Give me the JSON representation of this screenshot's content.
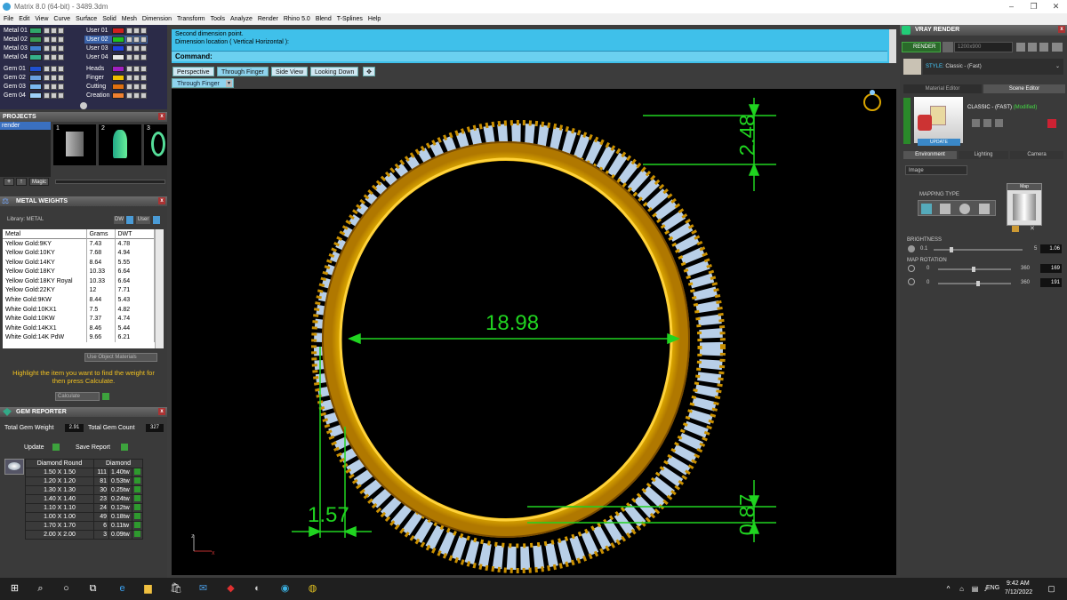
{
  "window": {
    "title": "Matrix 8.0 (64-bit) - 3489.3dm"
  },
  "menu": [
    "File",
    "Edit",
    "View",
    "Curve",
    "Surface",
    "Solid",
    "Mesh",
    "Dimension",
    "Transform",
    "Tools",
    "Analyze",
    "Render",
    "Rhino 5.0",
    "Blend",
    "T-Splines",
    "Help"
  ],
  "layers": {
    "left": [
      {
        "name": "Metal 01",
        "color": "#2fa86a"
      },
      {
        "name": "Metal 02",
        "color": "#3a9a55"
      },
      {
        "name": "Metal 03",
        "color": "#3f7fd0"
      },
      {
        "name": "Metal 04",
        "color": "#35b08a"
      },
      {
        "name": "Gem 01",
        "color": "#2050d0"
      },
      {
        "name": "Gem 02",
        "color": "#6aa0e0"
      },
      {
        "name": "Gem 03",
        "color": "#7ab8f0"
      },
      {
        "name": "Gem 04",
        "color": "#9fd0f8"
      }
    ],
    "right": [
      {
        "name": "User 01",
        "color": "#d02020"
      },
      {
        "name": "User 02",
        "color": "#20c020"
      },
      {
        "name": "User 03",
        "color": "#2040e0"
      },
      {
        "name": "User 04",
        "color": "#e8e8e8"
      },
      {
        "name": "Heads",
        "color": "#a020c0"
      },
      {
        "name": "Finger",
        "color": "#f0c000"
      },
      {
        "name": "Cutting",
        "color": "#e07010"
      },
      {
        "name": "Creation",
        "color": "#f08030"
      }
    ]
  },
  "projects": {
    "title": "PROJECTS",
    "item": "render",
    "thumbs": [
      "1",
      "2",
      "3"
    ],
    "magic_label": "Magic"
  },
  "metal_weights": {
    "title": "METAL WEIGHTS",
    "library_label": "Library: METAL",
    "dw_label": "DW",
    "user_label": "User",
    "columns": [
      "Metal",
      "Grams",
      "DWT"
    ],
    "rows": [
      [
        "Yellow Gold:9KY",
        "7.43",
        "4.78"
      ],
      [
        "Yellow Gold:10KY",
        "7.68",
        "4.94"
      ],
      [
        "Yellow Gold:14KY",
        "8.64",
        "5.55"
      ],
      [
        "Yellow Gold:18KY",
        "10.33",
        "6.64"
      ],
      [
        "Yellow Gold:18KY Royal",
        "10.33",
        "6.64"
      ],
      [
        "Yellow Gold:22KY",
        "12",
        "7.71"
      ],
      [
        "White Gold:9KW",
        "8.44",
        "5.43"
      ],
      [
        "White Gold:10KX1",
        "7.5",
        "4.82"
      ],
      [
        "White Gold:10KW",
        "7.37",
        "4.74"
      ],
      [
        "White Gold:14KX1",
        "8.46",
        "5.44"
      ],
      [
        "White Gold:14K PdW",
        "9.66",
        "6.21"
      ]
    ],
    "use_object_materials": "Use Object Materials",
    "hint": "Highlight the item you want to find the weight for then press Calculate.",
    "calculate": "Calculate"
  },
  "gem_reporter": {
    "title": "GEM REPORTER",
    "total_weight_label": "Total Gem Weight",
    "total_weight": "2.91",
    "total_count_label": "Total Gem Count",
    "total_count": "327",
    "update": "Update",
    "save_report": "Save Report",
    "head_left": "Diamond Round",
    "head_right": "Diamond",
    "rows": [
      [
        "1.50 X 1.50",
        "111",
        "1.40tw"
      ],
      [
        "1.20 X 1.20",
        "81",
        "0.53tw"
      ],
      [
        "1.30 X 1.30",
        "30",
        "0.25tw"
      ],
      [
        "1.40 X 1.40",
        "23",
        "0.24tw"
      ],
      [
        "1.10 X 1.10",
        "24",
        "0.12tw"
      ],
      [
        "1.00 X 1.00",
        "49",
        "0.18tw"
      ],
      [
        "1.70 X 1.70",
        "6",
        "0.11tw"
      ],
      [
        "2.00 X 2.00",
        "3",
        "0.09tw"
      ]
    ]
  },
  "command": {
    "line1": "Second dimension point.",
    "line2": "Dimension location ( Vertical  Horizontal ):",
    "prompt": "Command:"
  },
  "view_tabs": [
    "Perspective",
    "Through Finger",
    "Side View",
    "Looking Down"
  ],
  "active_view": "Through Finger",
  "dimensions": {
    "top": "2.48",
    "diameter": "18.98",
    "bottom_left": "1.57",
    "bottom_right": "0.87"
  },
  "vray": {
    "title": "VRAY RENDER",
    "render_btn": "RENDER",
    "resolution": "1200x900",
    "style_label": "STYLE:",
    "style_value": "Classic - (Fast)",
    "tabs": [
      "Material Editor",
      "Scene Editor"
    ],
    "preset_name": "CLASSIC - (FAST)",
    "modified": "(Modified)",
    "update": "UPDATE",
    "env_tabs": [
      "Environment",
      "Lighting",
      "Camera"
    ],
    "env_select": "Image",
    "mapping_type": "MAPPING TYPE",
    "map_label": "Map",
    "brightness_label": "BRIGHTNESS",
    "brightness_min": "0.1",
    "brightness_max": "5",
    "brightness_value": "1.06",
    "rotation_label": "MAP ROTATION",
    "rot1_min": "0",
    "rot1_max": "360",
    "rot1_value": "169",
    "rot2_min": "0",
    "rot2_max": "360",
    "rot2_value": "191"
  },
  "taskbar": {
    "lang": "ENG",
    "time": "9:42 AM",
    "date": "7/12/2022"
  },
  "colors": {
    "dim_green": "#20d420",
    "gold": "#e8a800",
    "command_blue": "#3fc0ea"
  }
}
